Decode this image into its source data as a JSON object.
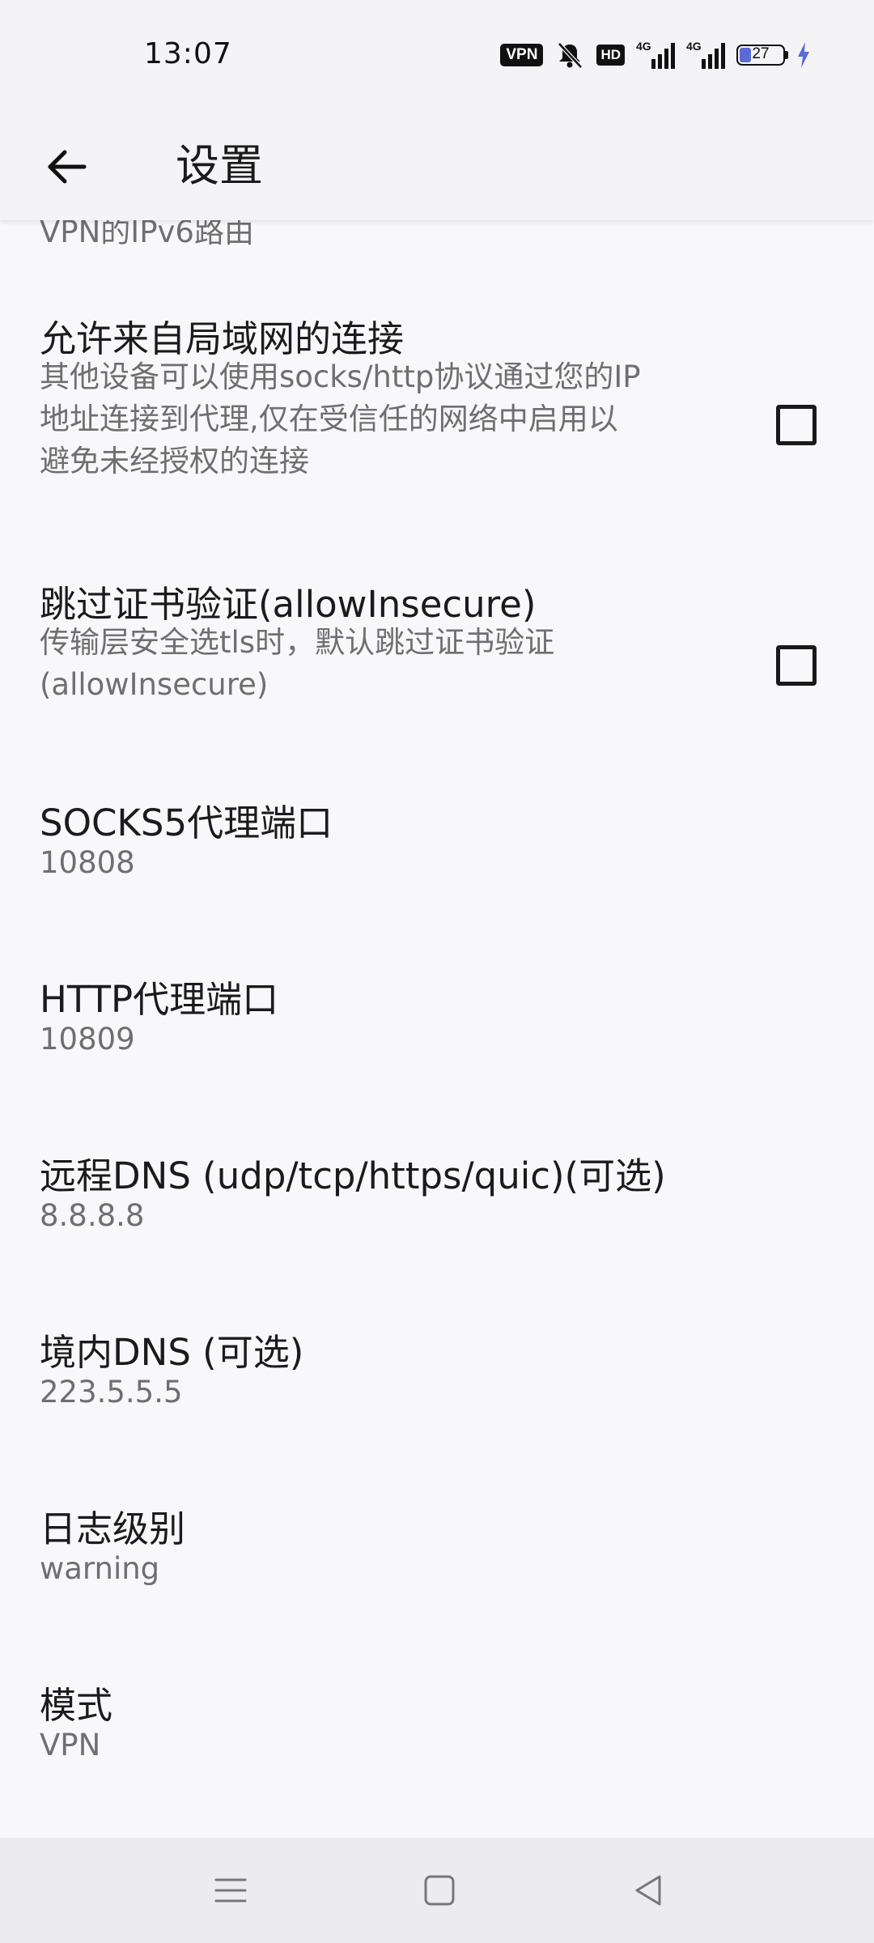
{
  "status_bar": {
    "time": "13:07",
    "vpn_badge": "VPN",
    "hd_badge": "HD",
    "signal_1_label": "4G",
    "signal_2_label": "4G",
    "battery_level": "27",
    "battery_fraction": 0.27,
    "charging_color": "#5a6bd6",
    "icons": [
      "vpn-badge",
      "muted-bell-icon",
      "hd-icon",
      "signal-4g-icon",
      "signal-4g-icon",
      "battery-icon",
      "charging-bolt-icon"
    ]
  },
  "app_bar": {
    "back_icon": "arrow-left-icon",
    "title": "设置"
  },
  "settings": {
    "partial_summary": "VPN的IPv6路由",
    "allow_lan": {
      "title": "允许来自局域网的连接",
      "summary_lines": [
        "其他设备可以使用socks/http协议通过您的IP",
        "地址连接到代理,仅在受信任的网络中启用以",
        "避免未经授权的连接"
      ],
      "checked": false
    },
    "allow_insecure": {
      "title": "跳过证书验证(allowInsecure)",
      "summary_lines": [
        "传输层安全选tls时，默认跳过证书验证",
        "(allowInsecure)"
      ],
      "checked": false
    },
    "socks_port": {
      "title": "SOCKS5代理端口",
      "value": "10808"
    },
    "http_port": {
      "title": "HTTP代理端口",
      "value": "10809"
    },
    "remote_dns": {
      "title": "远程DNS (udp/tcp/https/quic)(可选)",
      "value": "8.8.8.8"
    },
    "domestic_dns": {
      "title": "境内DNS (可选)",
      "value": "223.5.5.5"
    },
    "log_level": {
      "title": "日志级别",
      "value": "warning"
    },
    "mode": {
      "title": "模式",
      "value": "VPN"
    }
  },
  "nav_bar": {
    "icons": [
      "menu-icon",
      "home-square-icon",
      "back-triangle-icon"
    ]
  }
}
